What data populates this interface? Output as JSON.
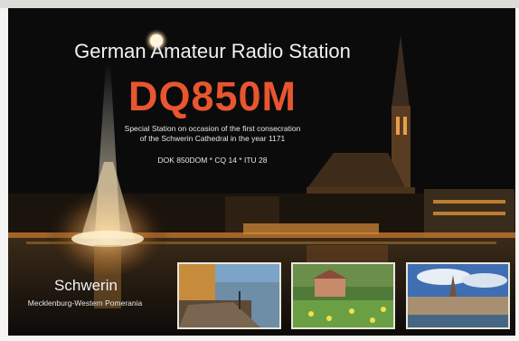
{
  "card": {
    "heading": "German Amateur Radio Station",
    "callsign": "DQ850M",
    "description_line1": "Special Station on occasion of the first consecration",
    "description_line2": "of the Schwerin Cathedral in the year 1171",
    "codes": "DOK 850DOM * CQ 14 * ITU 28",
    "city": "Schwerin",
    "region": "Mecklenburg-Western Pomerania"
  },
  "colors": {
    "callsign": "#e8552f",
    "night_sky": "#0a0a0a",
    "city_lights": "#f2a23a"
  },
  "images": {
    "background": "night view of Schwerin Cathedral and fountain over the lake",
    "thumbnails": [
      "lake shore with tree roots",
      "flower meadow with castle",
      "city skyline with cathedral under blue sky"
    ]
  }
}
